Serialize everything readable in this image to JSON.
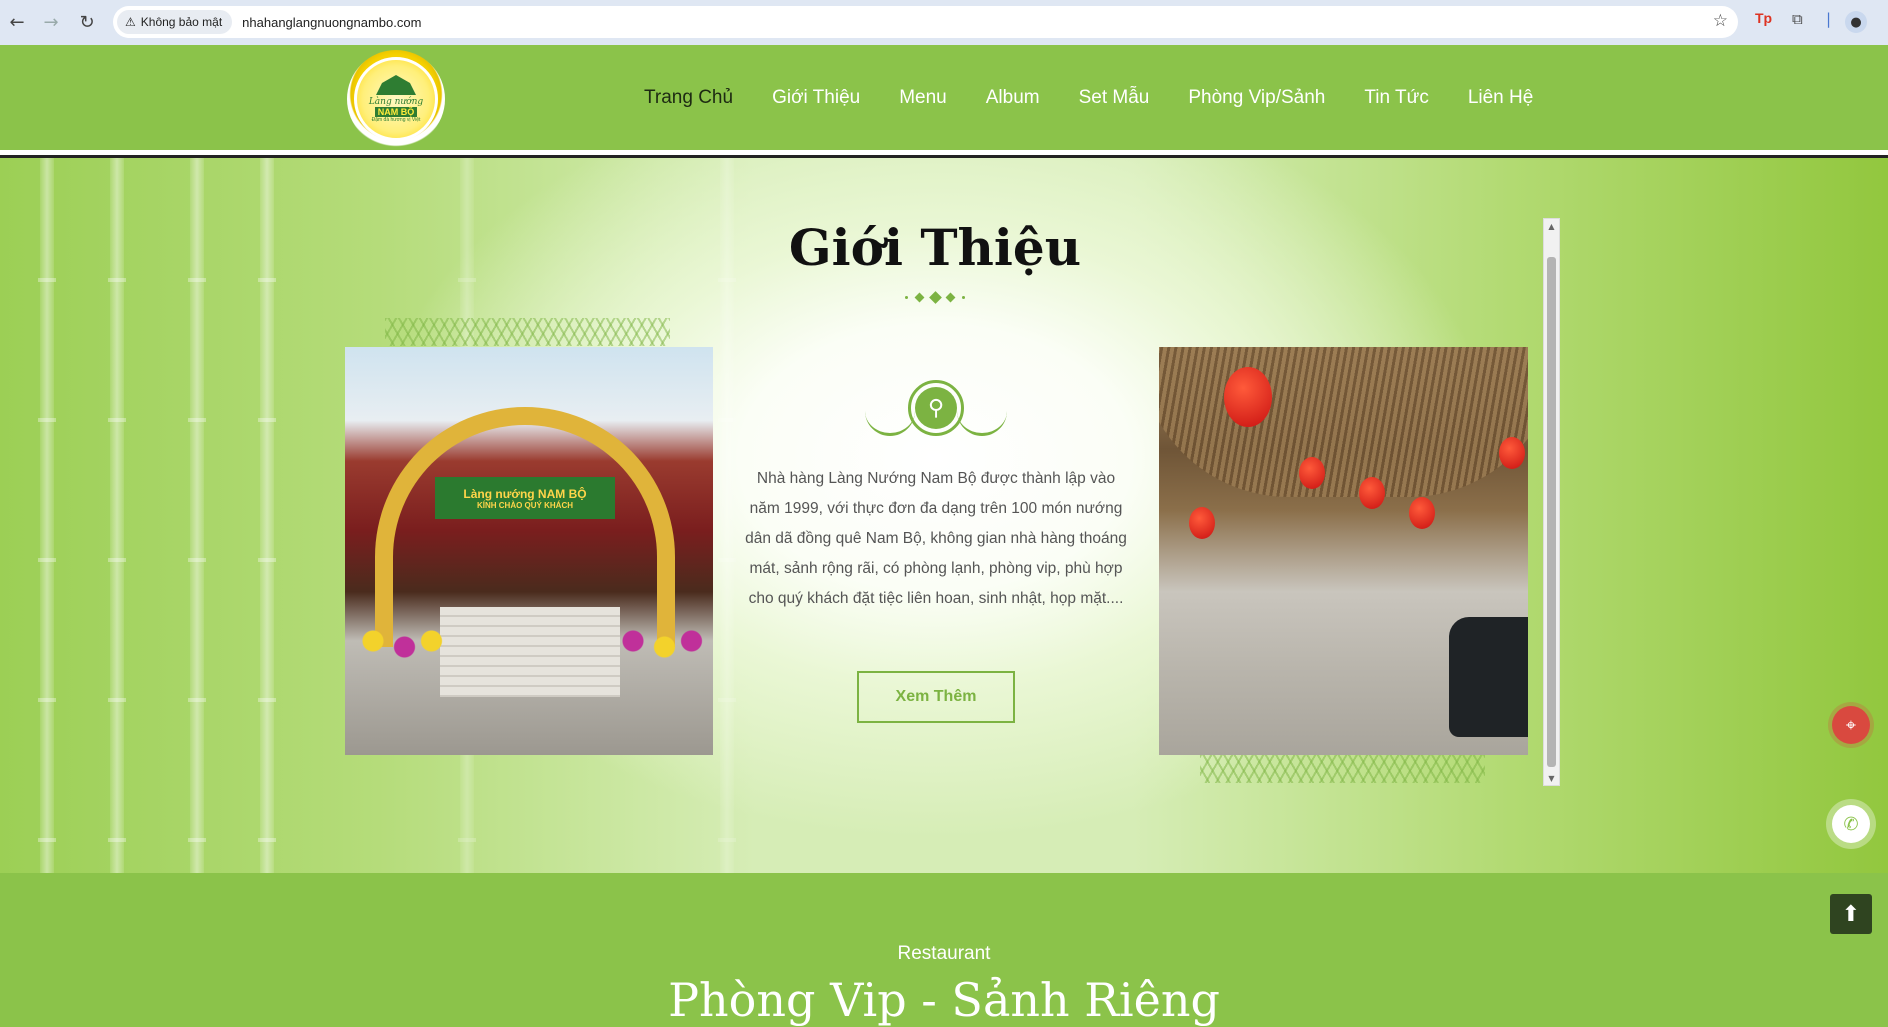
{
  "browser": {
    "security_label": "Không bảo mật",
    "url": "nhahanglangnuongnambo.com",
    "ext_label": "Tp"
  },
  "site": {
    "logo": {
      "line1": "Làng nướng",
      "line2": "NAM BỘ",
      "line3": "Đậm đà hương vị Việt"
    },
    "menu": [
      {
        "label": "Trang Chủ"
      },
      {
        "label": "Giới Thiệu"
      },
      {
        "label": "Menu"
      },
      {
        "label": "Album"
      },
      {
        "label": "Set Mẫu"
      },
      {
        "label": "Phòng Vip/Sảnh"
      },
      {
        "label": "Tin Tức"
      },
      {
        "label": "Liên Hệ"
      }
    ]
  },
  "intro": {
    "title": "Giới Thiệu",
    "text": "Nhà hàng Làng Nướng Nam Bộ được thành lập vào năm 1999, với thực đơn đa dạng trên 100 món nướng dân dã đồng quê Nam Bộ, không gian nhà hàng thoáng mát, sảnh rộng rãi, có phòng lạnh, phòng vip, phù hợp cho quý khách đặt tiệc liên hoan, sinh nhật, họp mặt....",
    "button_label": "Xem Thêm",
    "left_photo": {
      "sign_line1": "Làng nướng NAM BỘ",
      "sign_line2": "KÍNH CHÀO QUÝ KHÁCH"
    }
  },
  "next_section": {
    "subtitle": "Restaurant",
    "title": "Phòng Vip - Sảnh Riêng"
  },
  "icons": {
    "map": "map-pin-icon",
    "phone": "phone-icon",
    "to_top": "arrow-up-icon"
  },
  "colors": {
    "brand_green": "#8bc34a",
    "accent_green": "#7cb342",
    "map_red": "#d9493f"
  }
}
